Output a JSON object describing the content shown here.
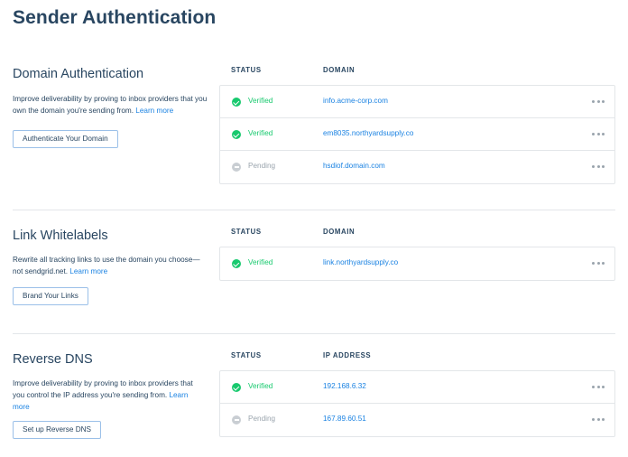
{
  "page": {
    "title": "Sender Authentication"
  },
  "colors": {
    "verified": "#18c96e",
    "pending": "#c9ced3",
    "link": "#1a82e2",
    "text": "#294661"
  },
  "sections": {
    "domain": {
      "title": "Domain Authentication",
      "desc": "Improve deliverability by proving to inbox providers that you own the domain you're sending from.",
      "learn_more": "Learn more",
      "button": "Authenticate Your Domain",
      "col_status": "STATUS",
      "col_value": "DOMAIN",
      "rows": [
        {
          "status": "Verified",
          "value": "info.acme-corp.com",
          "icon": "check-circle-icon"
        },
        {
          "status": "Verified",
          "value": "em8035.northyardsupply.co",
          "icon": "check-circle-icon"
        },
        {
          "status": "Pending",
          "value": "hsdiof.domain.com",
          "icon": "pending-circle-icon"
        }
      ]
    },
    "link": {
      "title": "Link Whitelabels",
      "desc": "Rewrite all tracking links to use the domain you choose—not sendgrid.net.",
      "learn_more": "Learn more",
      "button": "Brand Your Links",
      "col_status": "STATUS",
      "col_value": "DOMAIN",
      "rows": [
        {
          "status": "Verified",
          "value": "link.northyardsupply.co",
          "icon": "check-circle-icon"
        }
      ]
    },
    "rdns": {
      "title": "Reverse DNS",
      "desc": "Improve deliverability by proving to inbox providers that you control the IP address you're sending from.",
      "learn_more": "Learn more",
      "button": "Set up Reverse DNS",
      "col_status": "STATUS",
      "col_value": "IP ADDRESS",
      "rows": [
        {
          "status": "Verified",
          "value": "192.168.6.32",
          "icon": "check-circle-icon"
        },
        {
          "status": "Pending",
          "value": "167.89.60.51",
          "icon": "pending-circle-icon"
        }
      ]
    }
  }
}
